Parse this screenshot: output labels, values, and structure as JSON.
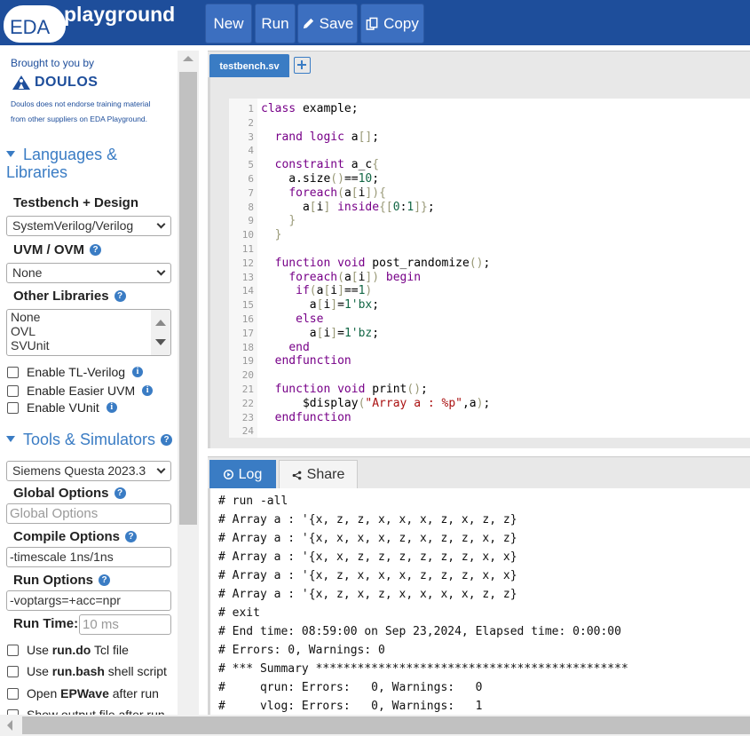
{
  "header": {
    "logo_eda": "EDA",
    "logo_playground": "playground",
    "buttons": {
      "new": "New",
      "run": "Run",
      "save": "Save",
      "copy": "Copy"
    }
  },
  "sidebar": {
    "brought_by": "Brought to you by",
    "doulos": "DOULOS",
    "disclaimer_line1": "Doulos does not endorse training material",
    "disclaimer_line2": "from other suppliers on EDA Playground.",
    "languages_title_1": "Languages &",
    "languages_title_2": "Libraries",
    "testbench_design_label": "Testbench + Design",
    "testbench_design_value": "SystemVerilog/Verilog",
    "uvm_label": "UVM / OVM",
    "uvm_value": "None",
    "other_libraries_label": "Other Libraries",
    "other_libraries_options": [
      "None",
      "OVL",
      "SVUnit"
    ],
    "enable_tl_verilog": "Enable TL-Verilog",
    "enable_easier_uvm": "Enable Easier UVM",
    "enable_vunit": "Enable VUnit",
    "tools_title": "Tools & Simulators",
    "simulator_value": "Siemens Questa 2023.3",
    "global_options_label": "Global Options",
    "global_options_placeholder": "Global Options",
    "compile_options_label": "Compile Options",
    "compile_options_value": "-timescale 1ns/1ns",
    "run_options_label": "Run Options",
    "run_options_value": "-voptargs=+acc=npr",
    "run_time_label": "Run Time:",
    "run_time_placeholder": "10 ms",
    "use_run_do_prefix": "Use ",
    "use_run_do_bold": "run.do",
    "use_run_do_suffix": " Tcl file",
    "use_run_bash_prefix": "Use ",
    "use_run_bash_bold": "run.bash",
    "use_run_bash_suffix": " shell script",
    "open_epwave_prefix": "Open ",
    "open_epwave_bold": "EPWave",
    "open_epwave_suffix": " after run",
    "show_output_file": "Show output file after run"
  },
  "editor": {
    "tab_name": "testbench.sv",
    "line_numbers": [
      "1",
      "2",
      "3",
      "4",
      "5",
      "6",
      "7",
      "8",
      "9",
      "10",
      "11",
      "12",
      "13",
      "14",
      "15",
      "16",
      "17",
      "18",
      "19",
      "20",
      "21",
      "22",
      "23",
      "24"
    ],
    "lines": [
      "class example;",
      "",
      "  rand logic a[];",
      "",
      "  constraint a_c{",
      "    a.size()==10;",
      "    foreach(a[i]){",
      "      a[i] inside{[0:1]};",
      "    }",
      "  }",
      "",
      "  function void post_randomize();",
      "    foreach(a[i]) begin",
      "     if(a[i]==1)",
      "       a[i]=1'bx;",
      "     else",
      "       a[i]=1'bz;",
      "    end",
      "  endfunction",
      "",
      "  function void print();",
      "      $display(\"Array a : %p\",a);",
      "  endfunction",
      ""
    ]
  },
  "log_panel": {
    "tab_log": "Log",
    "tab_share": "Share",
    "lines": [
      "# run -all",
      "# Array a : '{x, z, z, x, x, x, z, x, z, z}",
      "# Array a : '{x, x, x, x, z, x, z, z, x, z}",
      "# Array a : '{x, x, z, z, z, z, z, z, x, x}",
      "# Array a : '{x, z, x, x, x, z, z, z, x, x}",
      "# Array a : '{x, z, x, z, x, x, x, x, z, z}",
      "# exit",
      "# End time: 08:59:00 on Sep 23,2024, Elapsed time: 0:00:00",
      "# Errors: 0, Warnings: 0",
      "# *** Summary *********************************************",
      "#     qrun: Errors:   0, Warnings:   0",
      "#     vlog: Errors:   0, Warnings:   1"
    ]
  },
  "colors": {
    "topbar": "#1e4e9b",
    "button": "#3c6fc0",
    "accent": "#3a7cc4",
    "keyword": "#770088",
    "string": "#aa1111"
  }
}
